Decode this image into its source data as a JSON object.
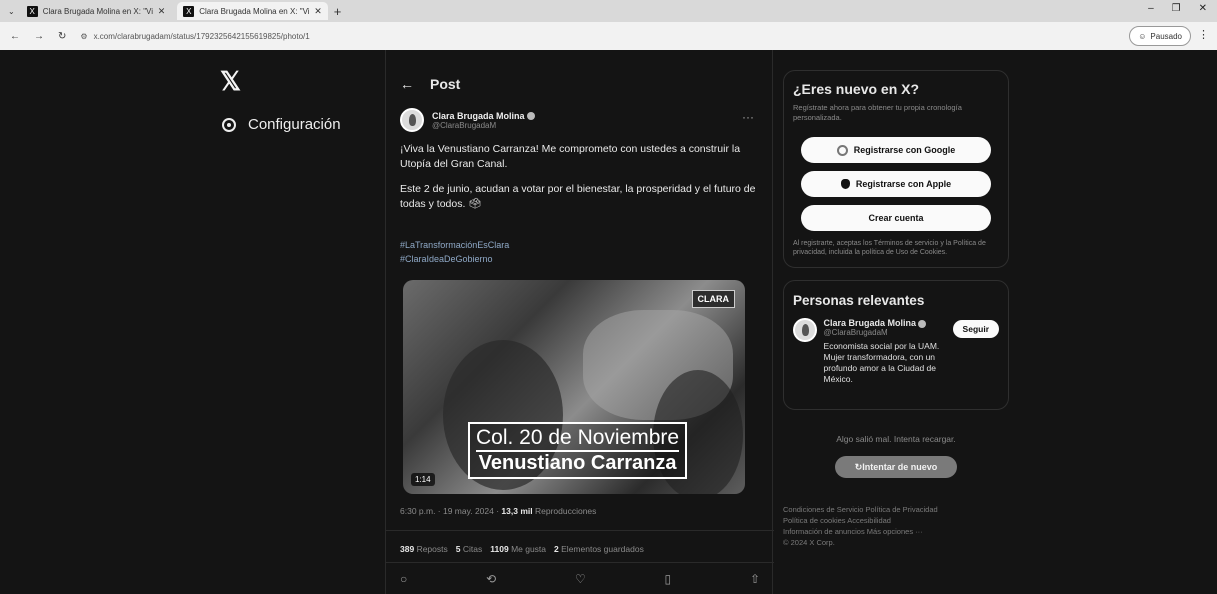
{
  "browser": {
    "tabs": [
      {
        "label": "Clara Brugada Molina en X: \"Viv",
        "active": false
      },
      {
        "label": "Clara Brugada Molina en X: \"Vi",
        "active": true
      }
    ],
    "url": "x.com/clarabrugadam/status/1792325642155619825/photo/1",
    "profile_label": "Pausado"
  },
  "nav": {
    "settings_label": "Configuración"
  },
  "post": {
    "header_title": "Post",
    "author_name": "Clara Brugada Molina",
    "author_handle": "@ClaraBrugadaM",
    "text_p1": "¡Viva la Venustiano Carranza! Me comprometo con ustedes a construir la Utopía del Gran Canal.",
    "text_p2": "Este 2 de junio, acudan a votar por el bienestar, la prosperidad y el futuro de todas y todos. 🗳",
    "hashtag_1": "#LaTransformaciónEsClara",
    "hashtag_2": "#ClaraIdeaDeGobierno",
    "media": {
      "brand": "CLARA",
      "caption_line1": "Col. 20 de Noviembre",
      "caption_line2": "Venustiano Carranza",
      "duration": "1:14"
    },
    "meta_time": "6:30 p.m. · 19 may. 2024 · ",
    "meta_views_count": "13,3 mil",
    "meta_views_label": " Reproducciones",
    "stats": {
      "reposts_count": "389",
      "reposts_label": "Reposts",
      "quotes_count": "5",
      "quotes_label": "Citas",
      "likes_count": "1109",
      "likes_label": "Me gusta",
      "saves_count": "2",
      "saves_label": "Elementos guardados"
    }
  },
  "sidebar": {
    "new_title": "¿Eres nuevo en X?",
    "new_subtitle": "Regístrate ahora para obtener tu propia cronología personalizada.",
    "google_button": "Registrarse con Google",
    "apple_button": "Registrarse con Apple",
    "create_button": "Crear cuenta",
    "terms": "Al registrarte, aceptas los Términos de servicio y la Política de privacidad, incluida la política de Uso de Cookies.",
    "relevant_title": "Personas relevantes",
    "rel_name": "Clara Brugada Molina",
    "rel_handle": "@ClaraBrugadaM",
    "rel_bio": "Economista social por la UAM. Mujer transformadora, con un profundo amor a la Ciudad de México.",
    "follow_button": "Seguir",
    "error_text": "Algo salió mal. Intenta recargar.",
    "retry_button": "Intentar de nuevo",
    "footer_line1": "Condiciones de Servicio   Política de Privacidad",
    "footer_line2": "Política de cookies   Accesibilidad",
    "footer_line3": "Información de anuncios   Más opciones ···",
    "footer_line4": "© 2024 X Corp."
  }
}
